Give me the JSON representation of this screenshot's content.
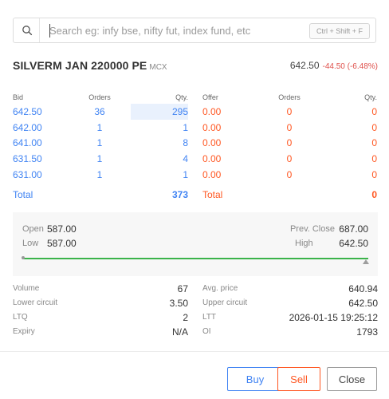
{
  "search": {
    "placeholder": "Search eg: infy bse, nifty fut, index fund, etc",
    "shortcut": "Ctrl + Shift + F"
  },
  "instrument": {
    "name": "SILVERM JAN 220000 PE",
    "exchange": "MCX",
    "ltp": "642.50",
    "change": "-44.50 (-6.48%)"
  },
  "depth": {
    "bid_headers": {
      "price": "Bid",
      "orders": "Orders",
      "qty": "Qty."
    },
    "offer_headers": {
      "price": "Offer",
      "orders": "Orders",
      "qty": "Qty."
    },
    "bids": [
      {
        "price": "642.50",
        "orders": "36",
        "qty": "295"
      },
      {
        "price": "642.00",
        "orders": "1",
        "qty": "1"
      },
      {
        "price": "641.00",
        "orders": "1",
        "qty": "8"
      },
      {
        "price": "631.50",
        "orders": "1",
        "qty": "4"
      },
      {
        "price": "631.00",
        "orders": "1",
        "qty": "1"
      }
    ],
    "offers": [
      {
        "price": "0.00",
        "orders": "0",
        "qty": "0"
      },
      {
        "price": "0.00",
        "orders": "0",
        "qty": "0"
      },
      {
        "price": "0.00",
        "orders": "0",
        "qty": "0"
      },
      {
        "price": "0.00",
        "orders": "0",
        "qty": "0"
      },
      {
        "price": "0.00",
        "orders": "0",
        "qty": "0"
      }
    ],
    "bid_total_label": "Total",
    "bid_total": "373",
    "offer_total_label": "Total",
    "offer_total": "0"
  },
  "ohlc": {
    "open_label": "Open",
    "open": "587.00",
    "low_label": "Low",
    "low": "587.00",
    "prev_close_label": "Prev. Close",
    "prev_close": "687.00",
    "high_label": "High",
    "high": "642.50"
  },
  "stats": {
    "volume_label": "Volume",
    "volume": "67",
    "avg_price_label": "Avg. price",
    "avg_price": "640.94",
    "lower_circuit_label": "Lower circuit",
    "lower_circuit": "3.50",
    "upper_circuit_label": "Upper circuit",
    "upper_circuit": "642.50",
    "ltq_label": "LTQ",
    "ltq": "2",
    "ltt_label": "LTT",
    "ltt": "2026-01-15 19:25:12",
    "expiry_label": "Expiry",
    "expiry": "N/A",
    "oi_label": "OI",
    "oi": "1793"
  },
  "buttons": {
    "buy": "Buy",
    "sell": "Sell",
    "close": "Close"
  },
  "colors": {
    "bid": "#4184f3",
    "offer": "#ff5722",
    "change_negative": "#df514c",
    "range_bar": "#3bb34a"
  },
  "icons": {
    "search": "search-icon"
  }
}
